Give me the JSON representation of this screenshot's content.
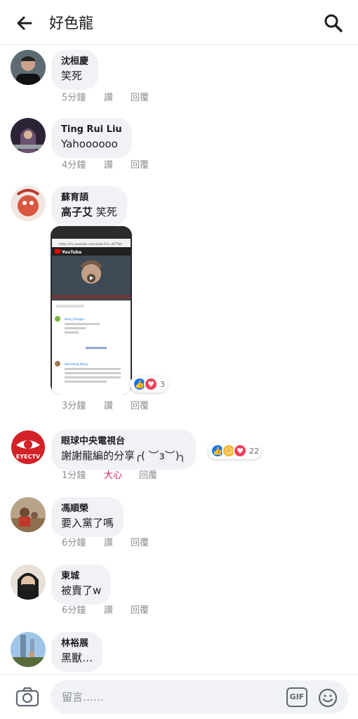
{
  "header": {
    "title": "好色龍"
  },
  "labels": {
    "like": "讚",
    "reply": "回覆"
  },
  "comments": [
    {
      "author": "沈桓慶",
      "text": "笑死",
      "time": "5分鐘"
    },
    {
      "author": "Ting Rui Liu",
      "text": "Yahoooooo",
      "time": "4分鐘"
    },
    {
      "author": "蘇育頡",
      "text_bold": "高子艾",
      "text": "笑死",
      "time": "3分鐘",
      "reaction_count": "3"
    },
    {
      "author": "眼球中央電視台",
      "text": "謝謝龍編的分享╭( ︶ɜ︶)╮",
      "time": "1分鐘",
      "my_reaction": "大心",
      "reaction_count": "22",
      "avatar_caption": "EYECTV"
    },
    {
      "author": "馮順榮",
      "text": "要入黨了嗎",
      "time": "6分鐘"
    },
    {
      "author": "東城",
      "text": "被賣了w",
      "time": "6分鐘"
    },
    {
      "author": "林裕展",
      "text": "黑獸…"
    }
  ],
  "attachment": {
    "url_bar": "https://m.youtube.com/watch?v=N7Tbh",
    "brand": "YouTube",
    "commenter_a": "Henry Dragon",
    "commenter_b": "sterosterg Wang"
  },
  "composer": {
    "placeholder": "留言……",
    "gif_label": "GIF"
  },
  "colors": {
    "accent_blue": "#1877f2",
    "love_red": "#e0245e",
    "bubble_gray": "#f0f2f5",
    "meta_gray": "#8a8d91"
  },
  "icons": [
    "back-arrow-icon",
    "search-icon",
    "camera-icon",
    "emoji-icon",
    "like-icon",
    "love-icon",
    "haha-icon",
    "play-icon"
  ]
}
